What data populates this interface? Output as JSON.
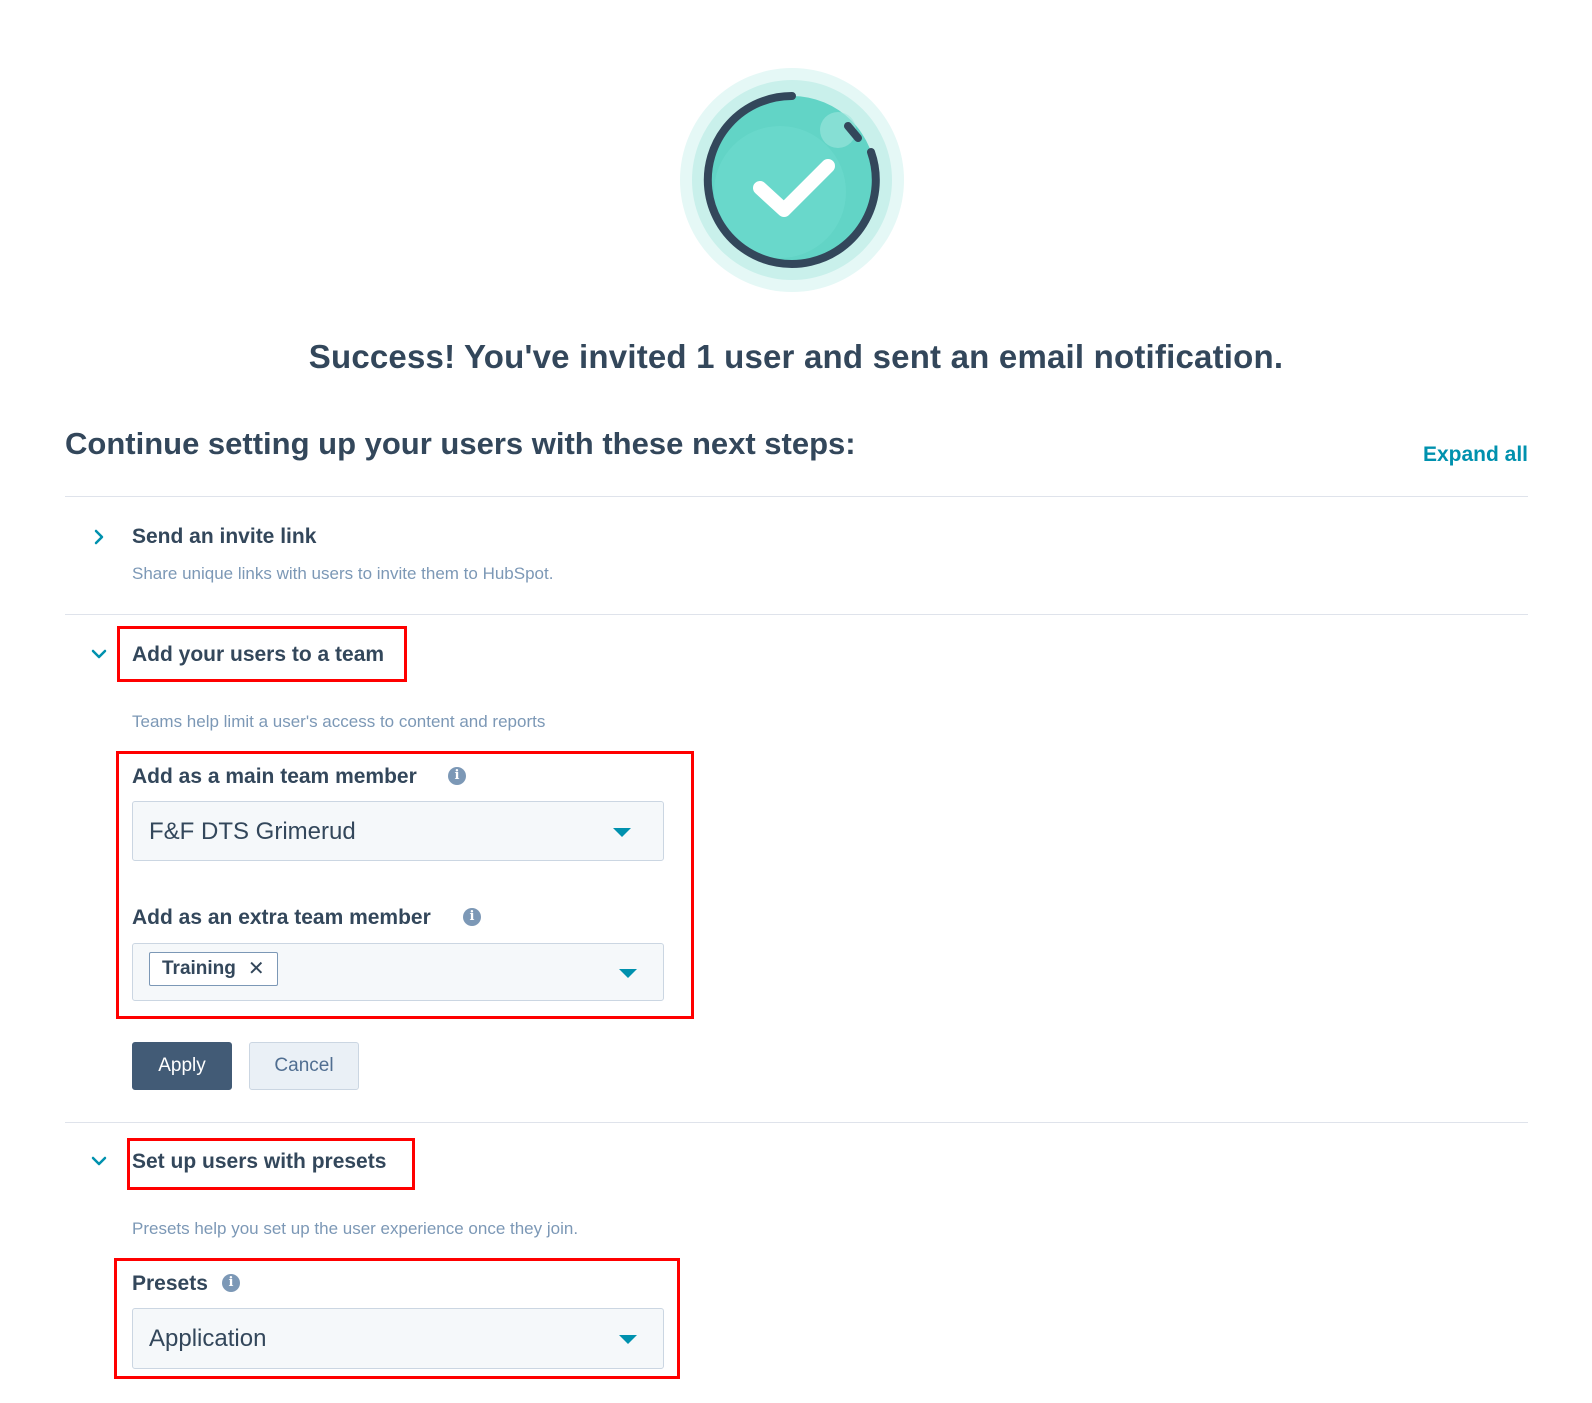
{
  "success": {
    "title": "Success! You've invited 1 user and sent an email notification."
  },
  "next_steps": {
    "heading": "Continue setting up your users with these next steps:",
    "expand_all": "Expand all"
  },
  "steps": [
    {
      "title": "Send an invite link",
      "description": "Share unique links with users to invite them to HubSpot.",
      "expanded": false
    },
    {
      "title": "Add your users to a team",
      "description": "Teams help limit a user's access to content and reports",
      "expanded": true,
      "main_team": {
        "label": "Add as a main team member",
        "value": "F&F DTS Grimerud"
      },
      "extra_team": {
        "label": "Add as an extra team member",
        "tags": [
          "Training"
        ]
      },
      "apply_label": "Apply",
      "cancel_label": "Cancel"
    },
    {
      "title": "Set up users with presets",
      "description": "Presets help you set up the user experience once they join.",
      "expanded": true,
      "presets": {
        "label": "Presets",
        "value": "Application"
      }
    }
  ],
  "icons": {
    "success": "checkmark-circle-icon",
    "collapsed": "chevron-right-icon",
    "expanded": "chevron-down-icon",
    "info": "info-icon",
    "dropdown": "caret-down-icon",
    "remove": "close-icon"
  },
  "colors": {
    "text": "#33475b",
    "muted": "#7c98b6",
    "accent": "#0091ae",
    "teal": "#6ad8cb",
    "primary_button": "#425b76",
    "highlight": "#ff0000"
  }
}
